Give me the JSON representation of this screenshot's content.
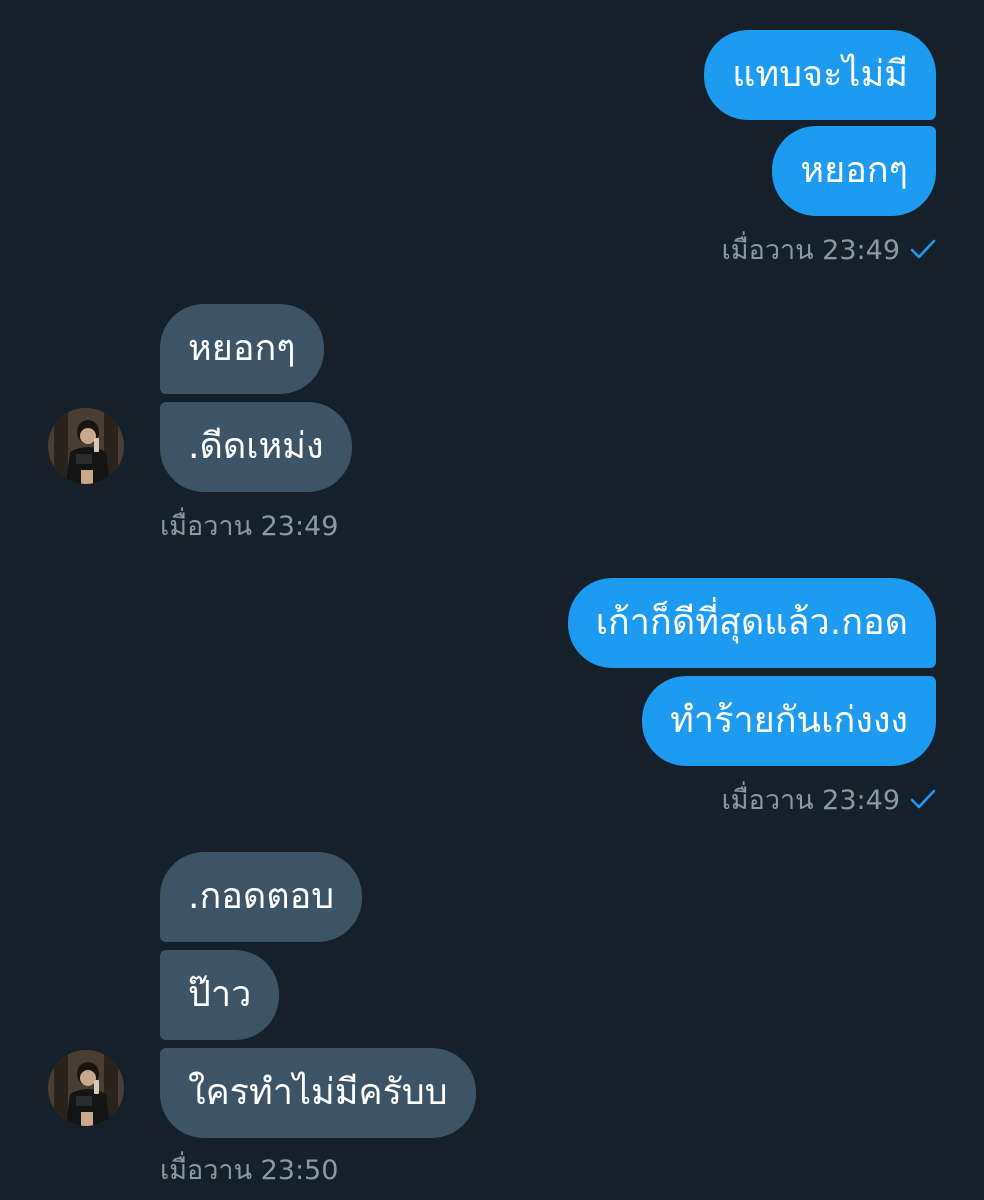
{
  "colors": {
    "background": "#15202b",
    "outgoing_bubble": "#1d9bf0",
    "incoming_bubble": "#3d5466",
    "timestamp": "#8b98a5",
    "read_check": "#1d9bf0"
  },
  "messages": {
    "group1": {
      "msg1": "แทบจะไม่มี",
      "msg2": "หยอกๆ",
      "time": "เมื่อวาน 23:49"
    },
    "group2": {
      "msg1": "หยอกๆ",
      "msg2": ".ดีดเหม่ง",
      "time": "เมื่อวาน 23:49"
    },
    "group3": {
      "msg1": "เก้าก็ดีที่สุดแล้ว.กอด",
      "msg2": "ทำร้ายกันเก่งงง",
      "time": "เมื่อวาน 23:49"
    },
    "group4": {
      "msg1": ".กอดตอบ",
      "msg2": "ป๊าว",
      "msg3": "ใครทำไม่มีครับบ",
      "time": "เมื่อวาน 23:50"
    }
  },
  "icons": {
    "read_receipt": "check-icon",
    "contact_avatar": "avatar"
  }
}
